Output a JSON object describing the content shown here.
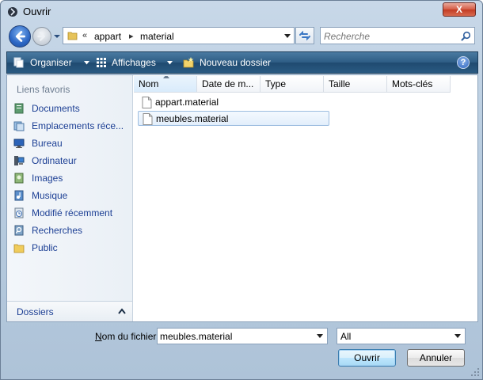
{
  "window": {
    "title": "Ouvrir",
    "close_label": "X"
  },
  "address": {
    "overflow": "«",
    "crumbs": [
      "appart",
      "material"
    ],
    "separator": "▸"
  },
  "search": {
    "placeholder": "Recherche"
  },
  "toolbar": {
    "organize": "Organiser",
    "views": "Affichages",
    "new_folder": "Nouveau dossier",
    "help": "?"
  },
  "sidebar": {
    "header": "Liens favoris",
    "items": [
      {
        "label": "Documents",
        "icon": "documents-icon"
      },
      {
        "label": "Emplacements réce...",
        "icon": "recent-places-icon"
      },
      {
        "label": "Bureau",
        "icon": "desktop-icon"
      },
      {
        "label": "Ordinateur",
        "icon": "computer-icon"
      },
      {
        "label": "Images",
        "icon": "pictures-icon"
      },
      {
        "label": "Musique",
        "icon": "music-icon"
      },
      {
        "label": "Modifié récemment",
        "icon": "recently-changed-icon"
      },
      {
        "label": "Recherches",
        "icon": "searches-icon"
      },
      {
        "label": "Public",
        "icon": "public-folder-icon"
      }
    ],
    "folders_label": "Dossiers"
  },
  "columns": [
    "Nom",
    "Date de m...",
    "Type",
    "Taille",
    "Mots-clés"
  ],
  "files": [
    {
      "name": "appart.material",
      "selected": false
    },
    {
      "name": "meubles.material",
      "selected": true
    }
  ],
  "bottom": {
    "filename_label_accel": "N",
    "filename_label_rest": "om du fichier :",
    "filename_value": "meubles.material",
    "filter_value": "All",
    "open_label": "Ouvrir",
    "cancel_label": "Annuler"
  },
  "colors": {
    "link": "#1c3f94",
    "toolbar": "#2d5c84",
    "selection_border": "#9dbde0"
  }
}
